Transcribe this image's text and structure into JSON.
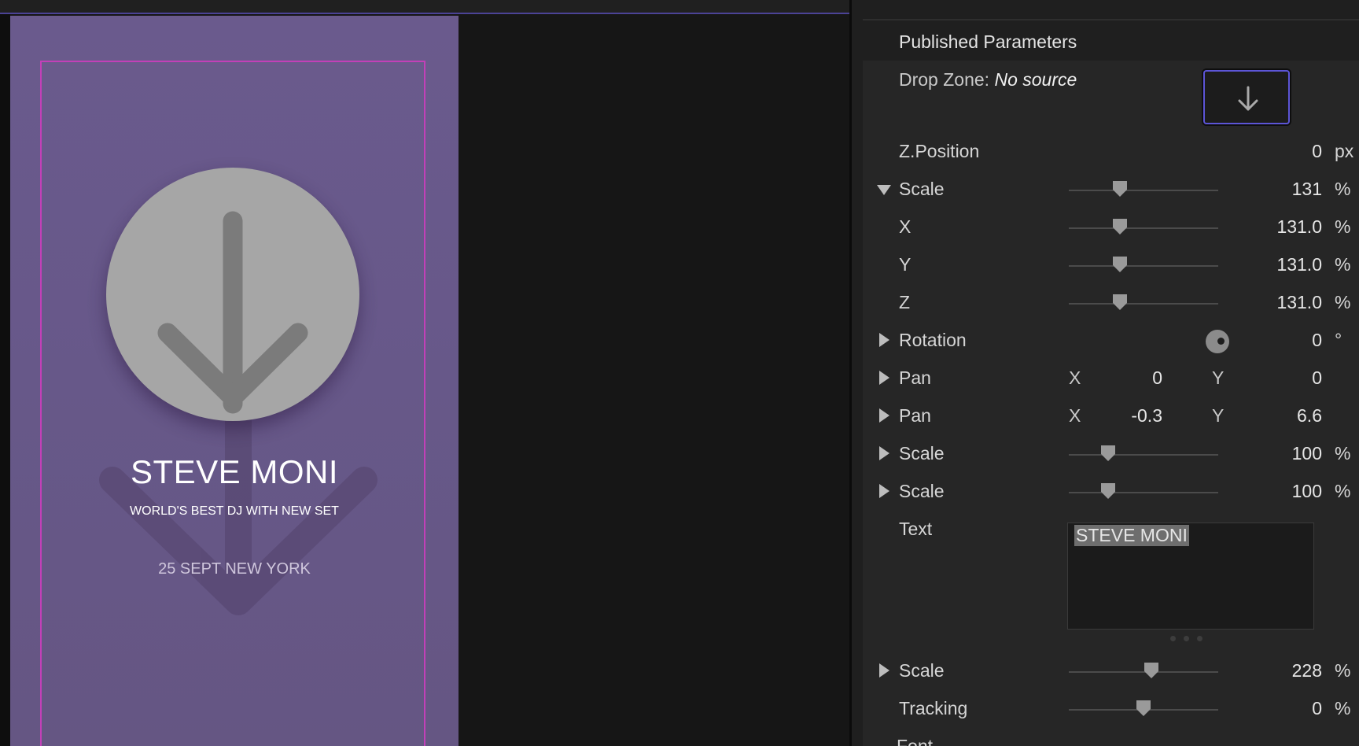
{
  "canvas": {
    "title": "STEVE MONI",
    "subtitle": "WORLD'S BEST DJ WITH NEW SET",
    "date": "25 SEPT NEW YORK"
  },
  "inspector": {
    "section_title": "Published Parameters",
    "drop_zone": {
      "label": "Drop Zone:",
      "value": "No source",
      "icon": "arrow-down-icon"
    },
    "rows": {
      "zposition": {
        "label": "Z.Position",
        "value": "0",
        "unit": "px"
      },
      "scale": {
        "label": "Scale",
        "value": "131",
        "unit": "%"
      },
      "scale_x": {
        "label": "X",
        "value": "131.0",
        "unit": "%"
      },
      "scale_y": {
        "label": "Y",
        "value": "131.0",
        "unit": "%"
      },
      "scale_z": {
        "label": "Z",
        "value": "131.0",
        "unit": "%"
      },
      "rotation": {
        "label": "Rotation",
        "value": "0",
        "unit": "°"
      },
      "pan1": {
        "label": "Pan",
        "x_label": "X",
        "x": "0",
        "y_label": "Y",
        "y": "0"
      },
      "pan2": {
        "label": "Pan",
        "x_label": "X",
        "x": "-0.3",
        "y_label": "Y",
        "y": "6.6"
      },
      "scale2": {
        "label": "Scale",
        "value": "100",
        "unit": "%"
      },
      "scale3": {
        "label": "Scale",
        "value": "100",
        "unit": "%"
      },
      "text": {
        "label": "Text",
        "value": "STEVE MONI"
      },
      "scale4": {
        "label": "Scale",
        "value": "228",
        "unit": "%"
      },
      "tracking": {
        "label": "Tracking",
        "value": "0",
        "unit": "%"
      }
    },
    "cut_off_row_label": "Font"
  },
  "colors": {
    "accent_frame": "#c240b8",
    "drop_well_border": "#5c55d6",
    "canvas_bg": "#6a5a8d"
  }
}
